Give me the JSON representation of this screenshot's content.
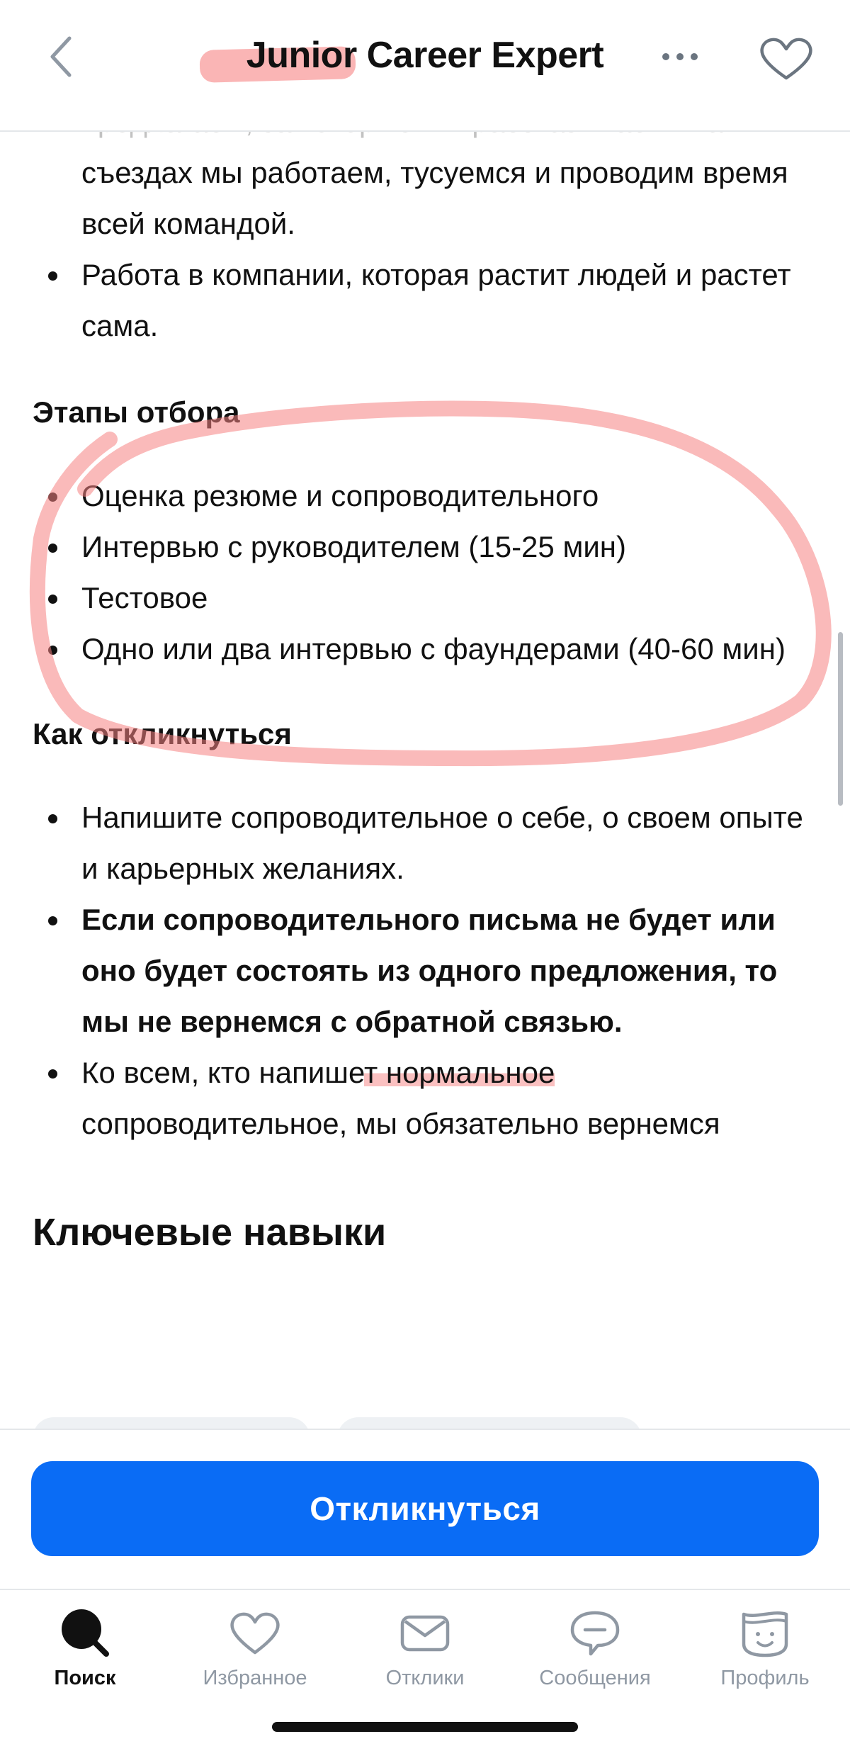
{
  "header": {
    "title": "Junior Career Expert",
    "icons": [
      "chevron-left-icon",
      "more-dots-icon",
      "heart-icon"
    ]
  },
  "content": {
    "intro_items": [
      "предлагаем, за которые мы рассказываем. На",
      "съездах мы работаем, тусуемся и проводим время всей командой.",
      "Работа в компании, которая растит людей и растет сама."
    ],
    "stages": {
      "title": "Этапы отбора",
      "items": [
        "Оценка резюме и сопроводительного",
        "Интервью с руководителем (15-25 мин)",
        "Тестовое",
        "Одно или два интервью с фаундерами (40-60 мин)"
      ]
    },
    "apply_info": {
      "title": "Как откликнуться",
      "item1": "Напишите сопроводительное о себе, о своем опыте и карьерных желаниях.",
      "item2": "Если сопроводительного письма не будет или оно будет состоять из одного предложения, то мы не вернемся с обратной связью.",
      "item3_pre": "Ко всем, кто напише",
      "item3_hl": "т нормальное",
      "item3_post": " сопроводительное, мы обязательно вернемся"
    },
    "skills_title": "Ключевые навыки"
  },
  "apply_button": "Откликнуться",
  "tabs": [
    {
      "label": "Поиск",
      "icon": "search-icon",
      "active": true
    },
    {
      "label": "Избранное",
      "icon": "heart-icon",
      "active": false
    },
    {
      "label": "Отклики",
      "icon": "envelope-icon",
      "active": false
    },
    {
      "label": "Сообщения",
      "icon": "chat-icon",
      "active": false
    },
    {
      "label": "Профиль",
      "icon": "profile-icon",
      "active": false
    }
  ],
  "colors": {
    "accent": "#0a6cf5",
    "annotation": "#f5a0a0",
    "tab_inactive": "#8f98a3"
  }
}
